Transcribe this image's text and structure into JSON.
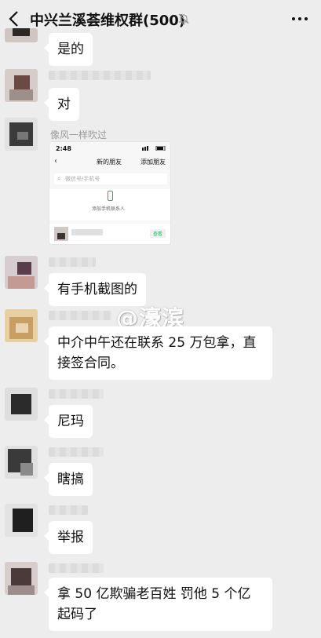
{
  "header": {
    "title": "中兴兰溪荟维权群(500)",
    "icons": {
      "back": "chevron-left-icon",
      "mute": "bell-muted-icon",
      "more": "more-dots-icon"
    }
  },
  "messages": [
    {
      "text": "是的"
    },
    {
      "text": "对"
    },
    {
      "sender": "像风一样吹过",
      "type": "image"
    },
    {
      "text": "有手机截图的"
    },
    {
      "text": "中介中午还在联系 25 万包拿，直接签合同。"
    },
    {
      "text": "尼玛"
    },
    {
      "text": "瞎搞"
    },
    {
      "text": "举报"
    },
    {
      "text": "拿 50 亿欺骗老百姓 罚他 5 个亿起码了"
    }
  ],
  "shared_screenshot": {
    "time": "2:48",
    "nav_title": "新的朋友",
    "nav_action": "添加朋友",
    "search_placeholder": "微信号/手机号",
    "add_contacts": "添加手机联系人",
    "view_button": "查看"
  },
  "watermark": "@濠滨"
}
